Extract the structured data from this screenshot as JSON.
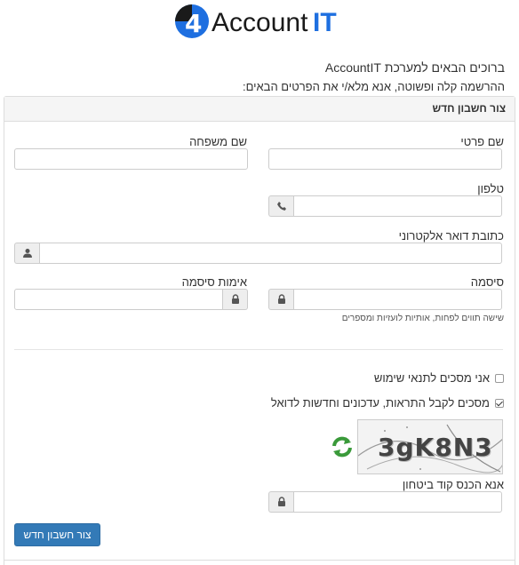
{
  "brand": {
    "logo_text_main": "Account",
    "logo_text_accent": "IT",
    "logo_mark": "4",
    "accent_color": "#1e6fe0",
    "dark_color": "#1a1a1a"
  },
  "welcome": "ברוכים הבאים למערכת AccountIT",
  "intro": "ההרשמה קלה ופשוטה, אנא מלא/י את הפרטים הבאים:",
  "panel": {
    "title": "צור חשבון חדש"
  },
  "form": {
    "first_name_label": "שם פרטי",
    "last_name_label": "שם משפחה",
    "phone_label": "טלפון",
    "email_label": "כתובת דואר אלקטרוני",
    "password_label": "סיסמה",
    "password_confirm_label": "אימות סיסמה",
    "password_hint": "שישה תווים לפחות, אותיות לועזיות ומספרים",
    "terms_label": "אני מסכים לתנאי שימוש",
    "terms_checked": false,
    "newsletter_label": "מסכים לקבל התראות, עדכונים וחדשות לדואל",
    "newsletter_checked": true,
    "captcha_text": "3gK8N3",
    "captcha_label": "אנא הכנס קוד ביטחון",
    "submit_label": "צור חשבון חדש"
  },
  "icons": {
    "phone": "phone-icon",
    "user": "user-icon",
    "lock": "lock-icon",
    "refresh": "refresh-icon"
  }
}
